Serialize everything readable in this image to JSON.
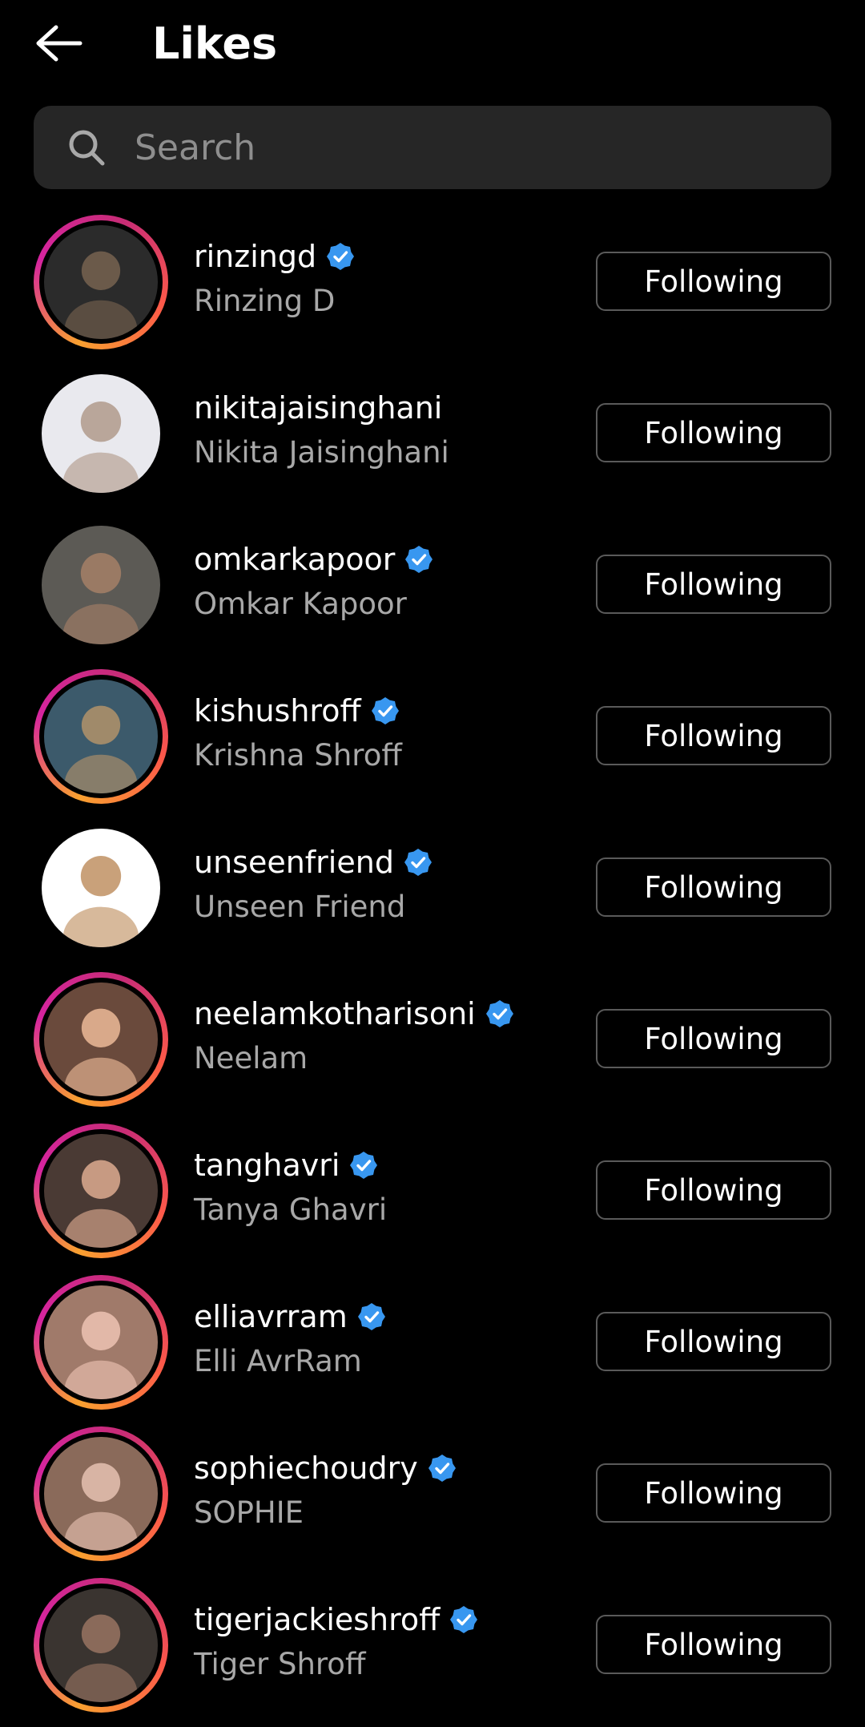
{
  "header": {
    "title": "Likes",
    "back_icon": "arrow-left-icon"
  },
  "search": {
    "placeholder": "Search",
    "value": "",
    "icon": "search-icon"
  },
  "colors": {
    "background": "#000000",
    "verified": "#3897f0",
    "secondary_text": "#a8a8a8"
  },
  "users": [
    {
      "username": "rinzingd",
      "full_name": "Rinzing D",
      "verified": true,
      "story_ring": true,
      "button": "Following"
    },
    {
      "username": "nikitajaisinghani",
      "full_name": "Nikita Jaisinghani",
      "verified": false,
      "story_ring": false,
      "button": "Following"
    },
    {
      "username": "omkarkapoor",
      "full_name": "Omkar Kapoor",
      "verified": true,
      "story_ring": false,
      "button": "Following"
    },
    {
      "username": "kishushroff",
      "full_name": "Krishna Shroff",
      "verified": true,
      "story_ring": true,
      "button": "Following"
    },
    {
      "username": "unseenfriend",
      "full_name": "Unseen Friend",
      "verified": true,
      "story_ring": false,
      "button": "Following"
    },
    {
      "username": "neelamkotharisoni",
      "full_name": "Neelam",
      "verified": true,
      "story_ring": true,
      "button": "Following"
    },
    {
      "username": "tanghavri",
      "full_name": "Tanya Ghavri",
      "verified": true,
      "story_ring": true,
      "button": "Following"
    },
    {
      "username": "elliavrram",
      "full_name": "Elli AvrRam",
      "verified": true,
      "story_ring": true,
      "button": "Following"
    },
    {
      "username": "sophiechoudry",
      "full_name": "SOPHIE",
      "verified": true,
      "story_ring": true,
      "button": "Following"
    },
    {
      "username": "tigerjackieshroff",
      "full_name": "Tiger Shroff",
      "verified": true,
      "story_ring": true,
      "button": "Following"
    }
  ]
}
